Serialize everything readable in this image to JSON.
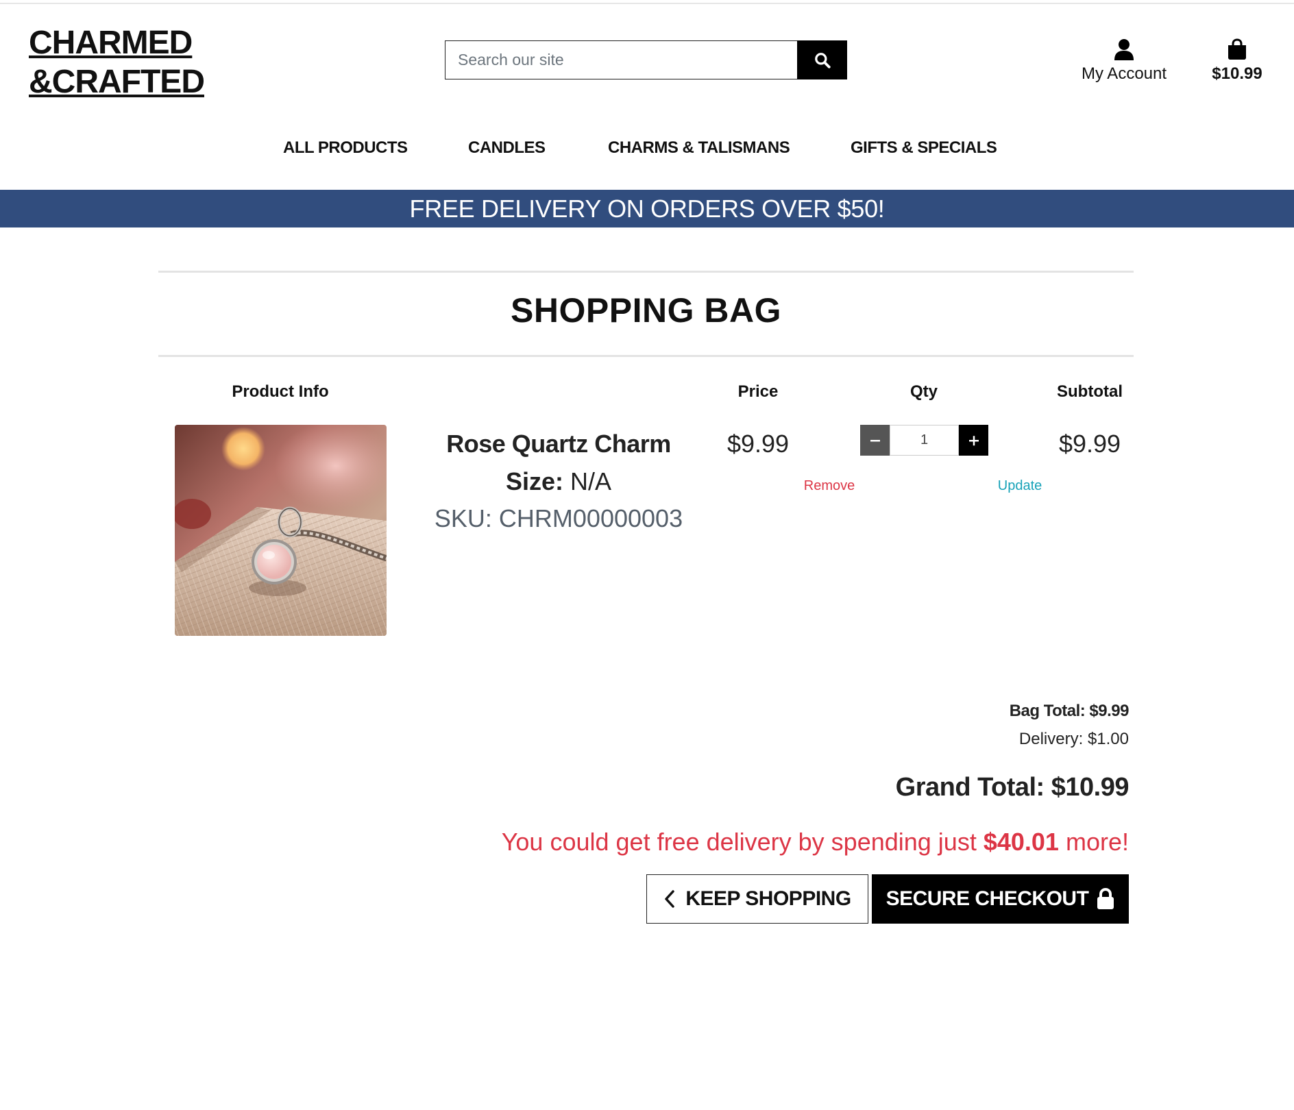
{
  "header": {
    "logo_line1": "CHARMED",
    "logo_line2": "&CRAFTED",
    "search_placeholder": "Search our site",
    "account_label": "My Account",
    "bag_amount": "$10.99"
  },
  "nav": {
    "items": [
      {
        "label": "ALL PRODUCTS"
      },
      {
        "label": "CANDLES"
      },
      {
        "label": "CHARMS & TALISMANS"
      },
      {
        "label": "GIFTS & SPECIALS"
      }
    ]
  },
  "banner": {
    "text": "FREE DELIVERY ON ORDERS OVER $50!"
  },
  "bag": {
    "title": "SHOPPING BAG",
    "columns": {
      "product_info": "Product Info",
      "price": "Price",
      "qty": "Qty",
      "subtotal": "Subtotal"
    },
    "items": [
      {
        "name": "Rose Quartz Charm",
        "size_label": "Size:",
        "size_value": "N/A",
        "sku": "SKU: CHRM00000003",
        "price": "$9.99",
        "quantity": "1",
        "subtotal": "$9.99",
        "remove_label": "Remove",
        "update_label": "Update"
      }
    ]
  },
  "totals": {
    "bag_total": "Bag Total: $9.99",
    "delivery": "Delivery: $1.00",
    "grand_total": "Grand Total: $10.99",
    "free_delivery_prefix": "You could get free delivery by spending just",
    "free_delivery_amount": "$40.01",
    "free_delivery_suffix": "more!"
  },
  "actions": {
    "keep_shopping": "KEEP SHOPPING",
    "secure_checkout": "SECURE CHECKOUT"
  },
  "colors": {
    "banner": "#314d7e",
    "remove": "#dc3545",
    "update": "#17a2b8",
    "alert": "#dc3545"
  },
  "icons": {
    "search": "search-icon",
    "account": "user-icon",
    "bag": "shopping-bag-icon",
    "back": "chevron-left-icon",
    "lock": "lock-icon"
  }
}
